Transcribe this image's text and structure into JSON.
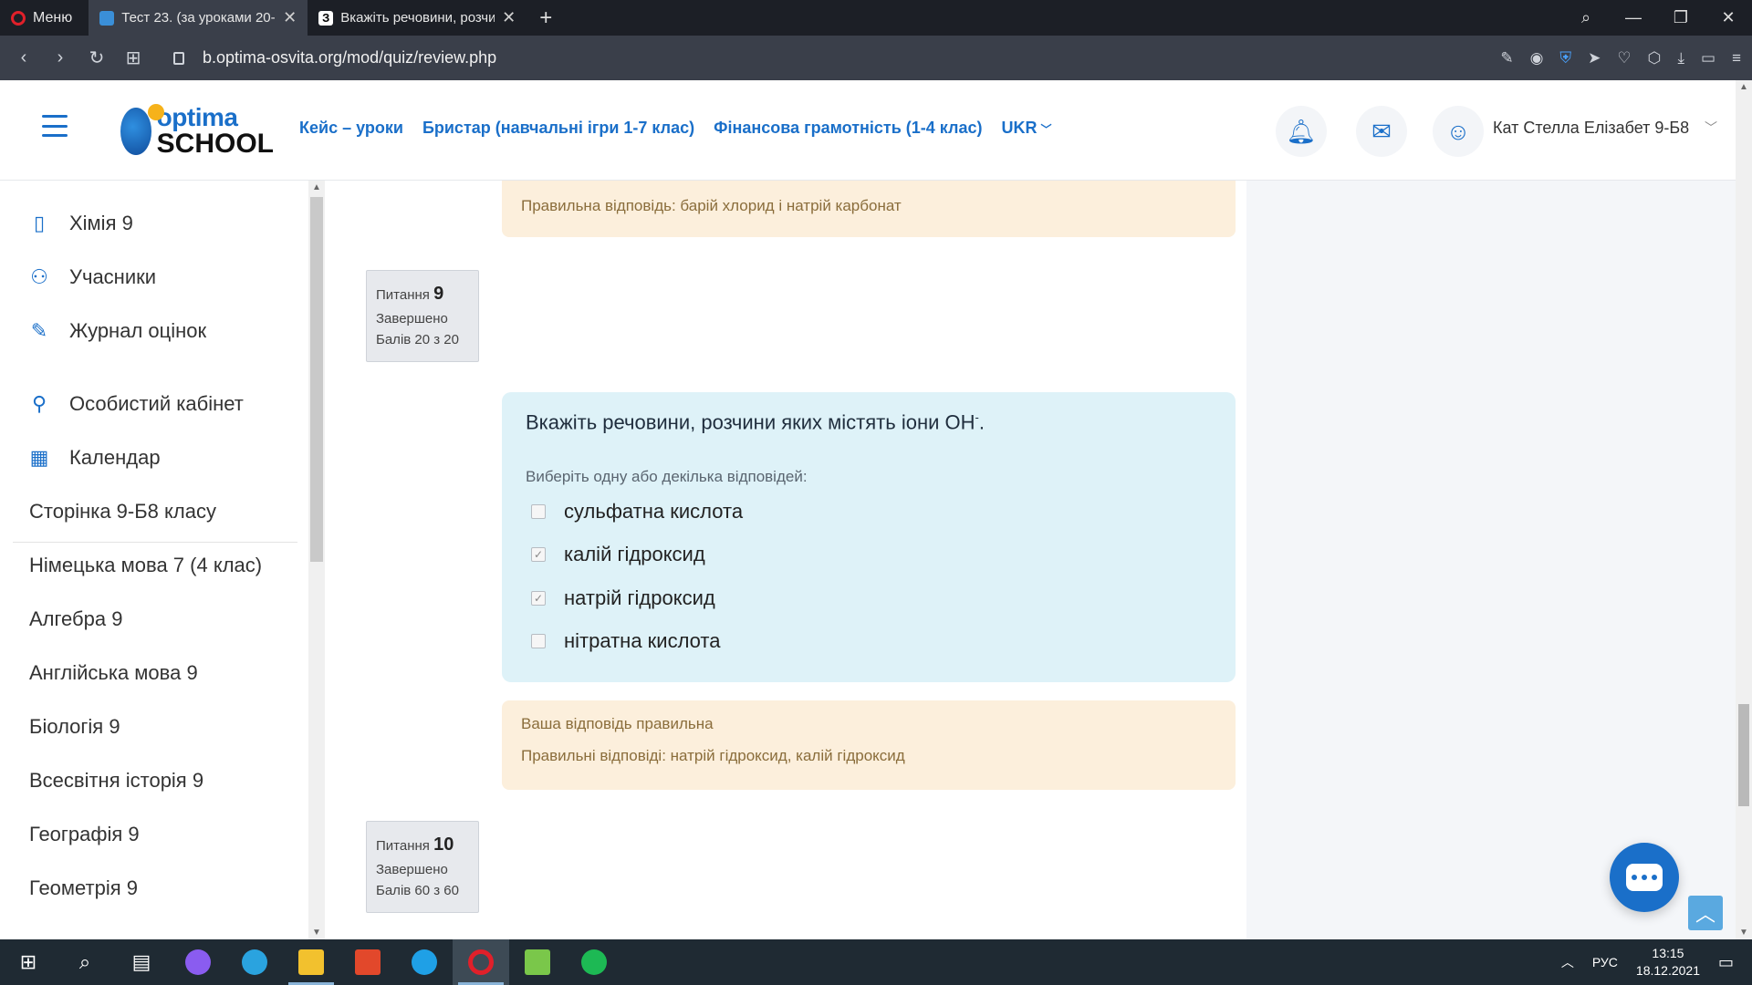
{
  "browser": {
    "menu_label": "Меню",
    "tabs": [
      {
        "title": "Тест 23. (за уроками 20-22"
      },
      {
        "title": "Вкажіть речовини, розчи"
      }
    ],
    "url": "b.optima-osvita.org/mod/quiz/review.php"
  },
  "header": {
    "logo_line1": "optima",
    "logo_line2": "SCHOOL",
    "nav": [
      {
        "label": "Кейс – уроки"
      },
      {
        "label": "Бристар (навчальні ігри 1-7 клас)"
      },
      {
        "label": "Фінансова грамотність (1-4 клас)"
      },
      {
        "label": "UKR"
      }
    ],
    "user_name": "Кат Стелла Елізабет 9-Б8"
  },
  "sidebar": {
    "items": [
      {
        "label": "Хімія 9",
        "icon": "notebook-icon"
      },
      {
        "label": "Учасники",
        "icon": "users-icon"
      },
      {
        "label": "Журнал оцінок",
        "icon": "edit-icon"
      },
      {
        "label": "Особистий кабінет",
        "icon": "user-icon"
      },
      {
        "label": "Календар",
        "icon": "calendar-icon"
      },
      {
        "label": "Сторінка 9-Б8 класу"
      },
      {
        "label": "Німецька мова 7 (4 клас)"
      },
      {
        "label": "Алгебра 9"
      },
      {
        "label": "Англійська мова 9"
      },
      {
        "label": "Біологія 9"
      },
      {
        "label": "Всесвітня історія 9"
      },
      {
        "label": "Географія 9"
      },
      {
        "label": "Геометрія 9"
      }
    ]
  },
  "quiz": {
    "prev_feedback": {
      "correct": "Правильна відповідь: барій хлорид і натрій карбонат"
    },
    "q9": {
      "label": "Питання",
      "number": "9",
      "state": "Завершено",
      "grade": "Балів 20 з 20",
      "text": "Вкажіть речовини, розчини яких містять іони OH",
      "sup": "-",
      "text_end": ".",
      "prompt": "Виберіть одну або декілька відповідей:",
      "answers": [
        {
          "label": "сульфатна кислота",
          "checked": false
        },
        {
          "label": "калій гідроксид",
          "checked": true
        },
        {
          "label": "натрій гідроксид",
          "checked": true
        },
        {
          "label": "нітратна кислота",
          "checked": false
        }
      ],
      "feedback_status": "Ваша відповідь правильна",
      "feedback_correct": "Правильні відповіді: натрій гідроксид, калій гідроксид"
    },
    "q10": {
      "label": "Питання",
      "number": "10",
      "state": "Завершено",
      "grade": "Балів 60 з 60"
    }
  },
  "taskbar": {
    "lang": "РУС",
    "time": "13:15",
    "date": "18.12.2021"
  }
}
